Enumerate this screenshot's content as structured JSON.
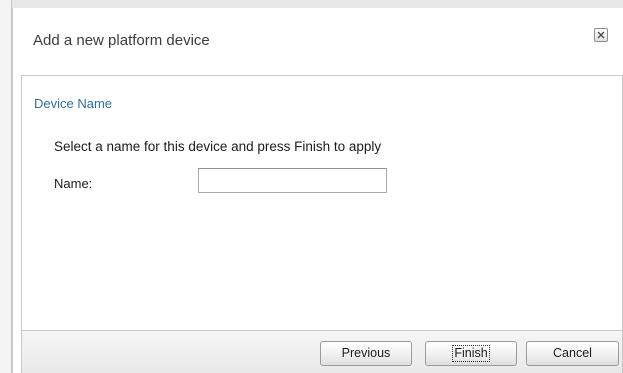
{
  "dialog": {
    "title": "Add a new platform device",
    "close_icon": "close-icon"
  },
  "section": {
    "title": "Device Name"
  },
  "form": {
    "instructions": "Select a name for this device and press Finish to apply",
    "name_label": "Name:",
    "name_value": "",
    "name_placeholder": ""
  },
  "footer": {
    "previous_label": "Previous",
    "finish_label": "Finish",
    "cancel_label": "Cancel"
  },
  "colors": {
    "section_title": "#2f6ea6",
    "border": "#c9c9c9"
  }
}
